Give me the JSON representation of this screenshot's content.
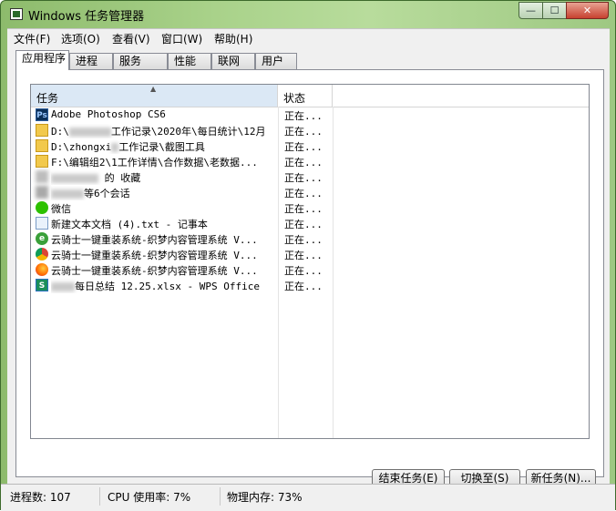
{
  "window": {
    "title": "Windows 任务管理器"
  },
  "caption_buttons": {
    "minimize": "—",
    "maximize": "☐",
    "close": "✕"
  },
  "menu": [
    {
      "label": "文件(F)"
    },
    {
      "label": "选项(O)"
    },
    {
      "label": "查看(V)"
    },
    {
      "label": "窗口(W)"
    },
    {
      "label": "帮助(H)"
    }
  ],
  "tabs": [
    {
      "label": "应用程序",
      "active": true
    },
    {
      "label": "进程"
    },
    {
      "label": "服务"
    },
    {
      "label": "性能"
    },
    {
      "label": "联网"
    },
    {
      "label": "用户"
    }
  ],
  "list": {
    "columns": {
      "task": "任务",
      "status": "状态"
    },
    "rows": [
      {
        "icon": "photoshop-icon",
        "name": "Adobe Photoshop CS6",
        "status": "正在..."
      },
      {
        "icon": "folder-icon",
        "name_parts": [
          "D:\\",
          "工作记录\\2020年\\每日统计\\12月"
        ],
        "status": "正在..."
      },
      {
        "icon": "folder-icon",
        "name_parts": [
          "D:\\zhongxi",
          "工作记录\\截图工具"
        ],
        "status": "正在..."
      },
      {
        "icon": "folder-icon",
        "name": "F:\\编辑组2\\1工作详情\\合作数据\\老数据...",
        "status": "正在..."
      },
      {
        "icon": "blurred-icon",
        "name_parts": [
          "",
          " 的 收藏"
        ],
        "status": "正在..."
      },
      {
        "icon": "blurred-icon",
        "name_parts": [
          "",
          "等6个会话"
        ],
        "status": "正在..."
      },
      {
        "icon": "wechat-icon",
        "name": "微信",
        "status": "正在..."
      },
      {
        "icon": "notepad-icon",
        "name": "新建文本文档 (4).txt - 记事本",
        "status": "正在..."
      },
      {
        "icon": "ie-icon",
        "name": "云骑士一键重装系统-织梦内容管理系统 V...",
        "status": "正在..."
      },
      {
        "icon": "chrome-icon",
        "name": "云骑士一键重装系统-织梦内容管理系统 V...",
        "status": "正在..."
      },
      {
        "icon": "firefox-icon",
        "name": "云骑士一键重装系统-织梦内容管理系统 V...",
        "status": "正在..."
      },
      {
        "icon": "wps-icon",
        "name_parts": [
          "",
          "每日总结 12.25.xlsx - WPS Office"
        ],
        "status": "正在..."
      }
    ]
  },
  "buttons": {
    "end_task": "结束任务(E)",
    "switch_to": "切换至(S)",
    "new_task": "新任务(N)..."
  },
  "statusbar": {
    "processes": "进程数: 107",
    "cpu": "CPU 使用率: 7%",
    "memory": "物理内存: 73%"
  },
  "colors": {
    "title_gradient": "#a9d28a",
    "header_selected": "#dbe8f5",
    "close_button": "#c7412f"
  }
}
